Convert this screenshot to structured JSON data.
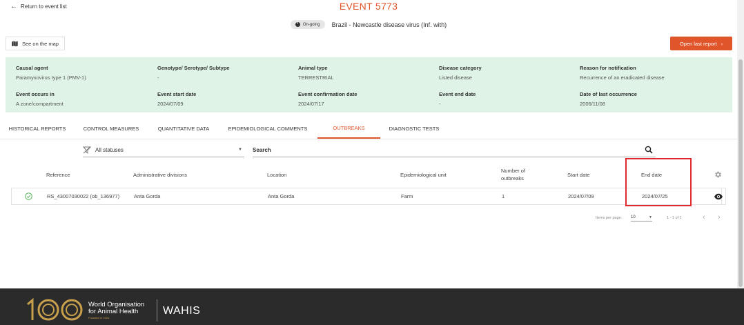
{
  "header": {
    "back_link": "Return to event list",
    "event_title": "EVENT 5773",
    "status_badge": "On-going",
    "disease_title": "Brazil - Newcastle disease virus (Inf. with)"
  },
  "actions": {
    "map_button": "See on the map",
    "open_report_button": "Open last report"
  },
  "info": {
    "causal_agent": {
      "label": "Causal agent",
      "value": "Paramyxovirus type 1 (PMV-1)"
    },
    "genotype": {
      "label": "Genotype/ Serotype/ Subtype",
      "value": "-"
    },
    "animal_type": {
      "label": "Animal type",
      "value": "TERRESTRIAL"
    },
    "disease_category": {
      "label": "Disease category",
      "value": "Listed disease"
    },
    "reason": {
      "label": "Reason for notification",
      "value": "Recurrence of an eradicated disease"
    },
    "event_occurs_in": {
      "label": "Event occurs in",
      "value": "A zone/compartment"
    },
    "start_date": {
      "label": "Event start date",
      "value": "2024/07/09"
    },
    "confirmation_date": {
      "label": "Event confirmation date",
      "value": "2024/07/17"
    },
    "end_date": {
      "label": "Event end date",
      "value": "-"
    },
    "last_occurrence": {
      "label": "Date of last occurrence",
      "value": "2006/11/08"
    }
  },
  "tabs": [
    {
      "label": "HISTORICAL REPORTS"
    },
    {
      "label": "CONTROL MEASURES"
    },
    {
      "label": "QUANTITATIVE DATA"
    },
    {
      "label": "EPIDEMIOLOGICAL COMMENTS"
    },
    {
      "label": "OUTBREAKS"
    },
    {
      "label": "DIAGNOSTIC TESTS"
    }
  ],
  "active_tab": "OUTBREAKS",
  "filters": {
    "status": "All statuses",
    "search_placeholder": "Search"
  },
  "table": {
    "columns": {
      "reference": "Reference",
      "admin_divisions": "Administrative divisions",
      "location": "Location",
      "epi_unit": "Epidemiological unit",
      "num_outbreaks_1": "Number of",
      "num_outbreaks_2": "outbreaks",
      "start_date": "Start date",
      "end_date": "End date"
    },
    "rows": [
      {
        "reference": "RS_43007030022 (ob_136977)",
        "admin_divisions": "Anta Gorda",
        "location": "Anta Gorda",
        "epi_unit": "Farm",
        "num_outbreaks": "1",
        "start_date": "2024/07/09",
        "end_date": "2024/07/25"
      }
    ]
  },
  "pagination": {
    "items_per_page_label": "Items per page:",
    "items_per_page": "10",
    "range": "1 - 1 of 1"
  },
  "footer": {
    "org_line1": "World Organisation",
    "org_line2": "for Animal Health",
    "founded": "Founded in 1924",
    "app_name": "WAHIS"
  },
  "colors": {
    "accent": "#e0552a",
    "info_panel_bg": "#dff4e7",
    "highlight_box": "#e0282d",
    "footer_bg": "#2b2b2b",
    "status_ok": "#4caf50"
  },
  "icons": {
    "back": "arrow-left-icon",
    "status": "info-icon",
    "map": "map-icon",
    "report": "chevron-right-icon",
    "filter": "filter-off-icon",
    "search": "search-icon",
    "settings": "gear-icon",
    "row_status": "check-circle-icon",
    "view": "eye-icon"
  }
}
